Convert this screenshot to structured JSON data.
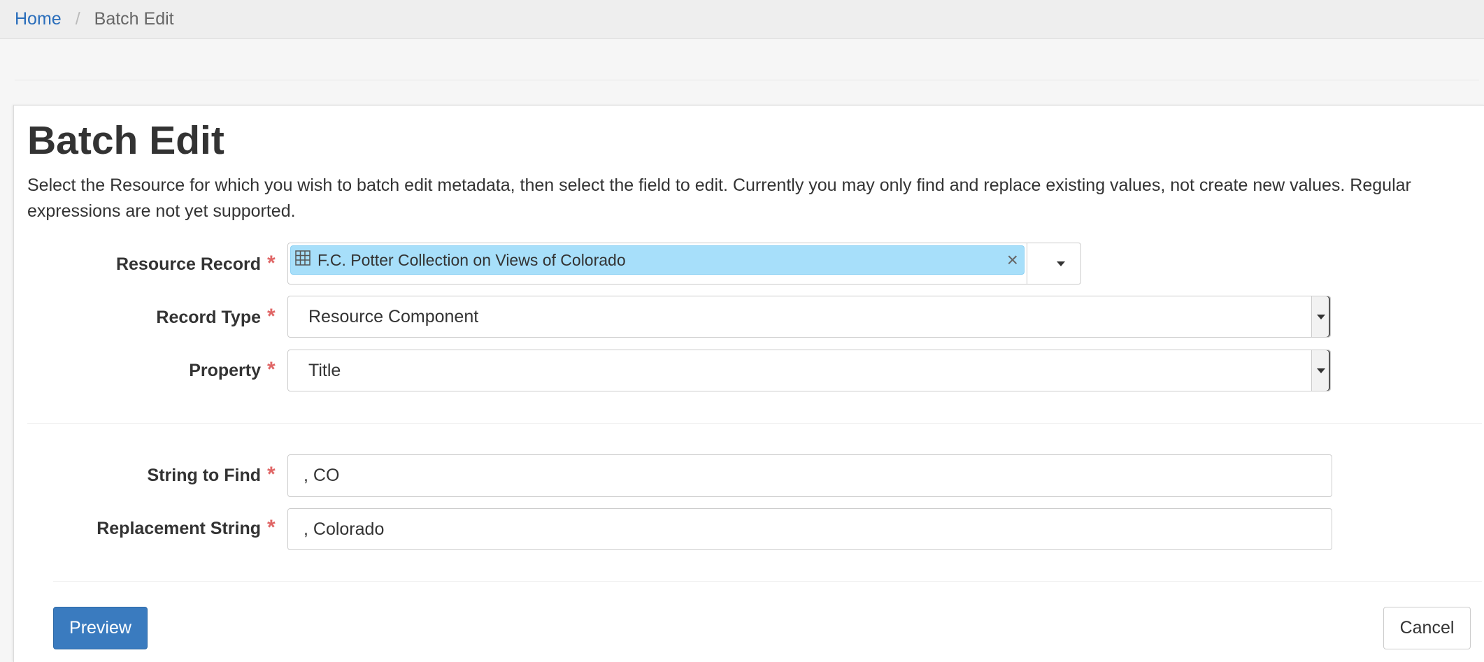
{
  "breadcrumb": {
    "home": "Home",
    "separator": "/",
    "current": "Batch Edit"
  },
  "page": {
    "title": "Batch Edit",
    "description": "Select the Resource for which you wish to batch edit metadata, then select the field to edit. Currently you may only find and replace existing values, not create new values. Regular expressions are not yet supported."
  },
  "form": {
    "required_marker": "*",
    "resource_record": {
      "label": "Resource Record",
      "token_text": "F.C. Potter Collection on Views of Colorado",
      "token_icon": "table-icon",
      "remove_symbol": "×"
    },
    "record_type": {
      "label": "Record Type",
      "value": "Resource Component"
    },
    "property": {
      "label": "Property",
      "value": "Title"
    },
    "string_to_find": {
      "label": "String to Find",
      "value": ", CO"
    },
    "replacement_string": {
      "label": "Replacement String",
      "value": ", Colorado"
    }
  },
  "actions": {
    "preview": "Preview",
    "cancel": "Cancel"
  },
  "colors": {
    "link": "#2a6ebb",
    "required": "#e06666",
    "token_bg": "#a7dffa",
    "primary_button": "#3a7bbf"
  }
}
